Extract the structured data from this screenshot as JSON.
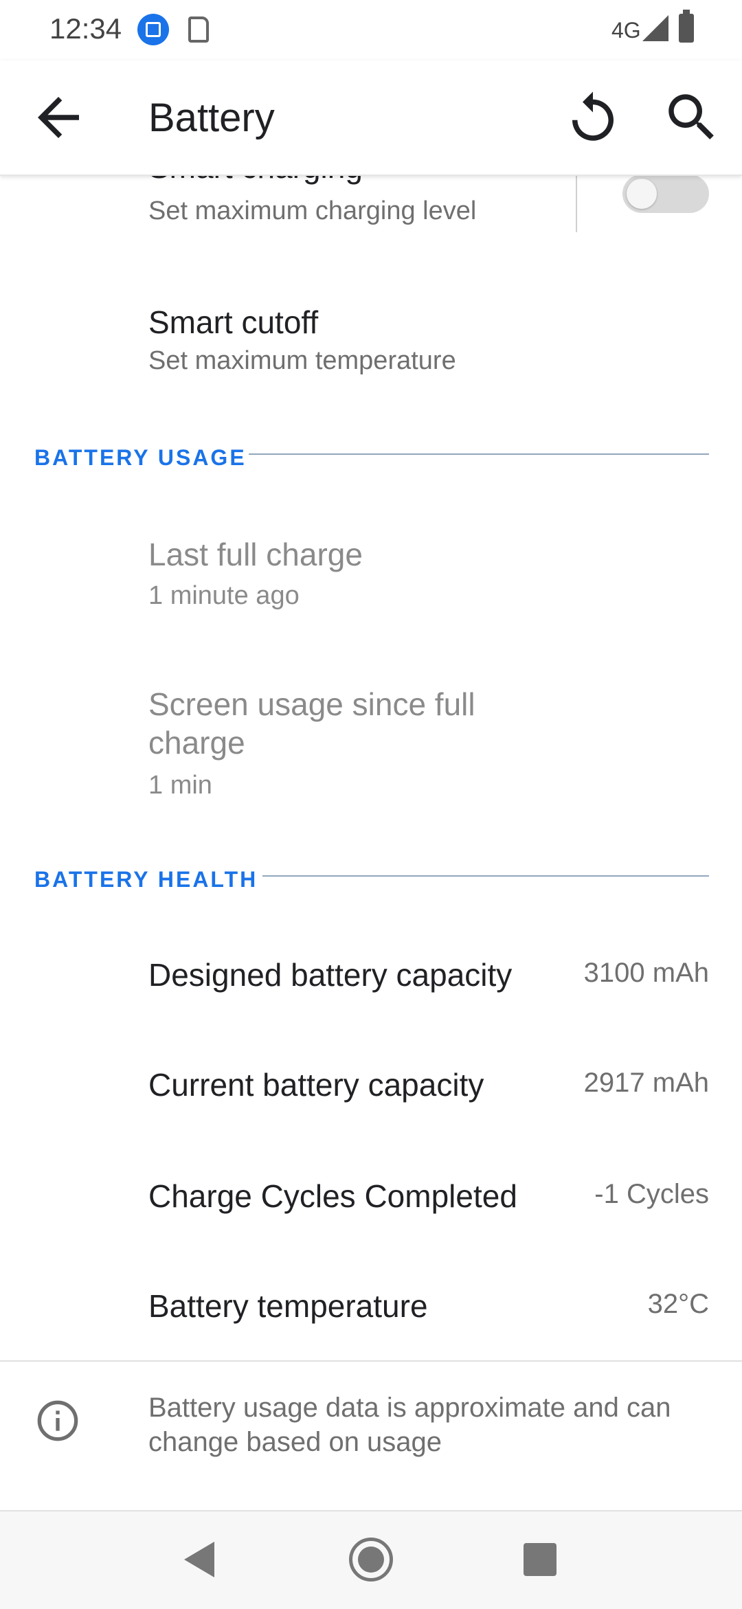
{
  "status_bar": {
    "time": "12:34",
    "network": "4G"
  },
  "app_bar": {
    "title": "Battery"
  },
  "settings": {
    "smart_charging": {
      "title": "Smart charging",
      "summary": "Set maximum charging level",
      "toggle_on": false
    },
    "smart_cutoff": {
      "title": "Smart cutoff",
      "summary": "Set maximum temperature"
    }
  },
  "battery_usage": {
    "header": "BATTERY USAGE",
    "last_full_charge": {
      "title": "Last full charge",
      "summary": "1 minute ago"
    },
    "screen_usage": {
      "title_line1": "Screen usage since full",
      "title_line2": "charge",
      "summary": "1 min"
    }
  },
  "battery_health": {
    "header": "BATTERY HEALTH",
    "rows": [
      {
        "label": "Designed battery capacity",
        "value": "3100 mAh"
      },
      {
        "label": "Current battery capacity",
        "value": "2917 mAh"
      },
      {
        "label": "Charge Cycles Completed",
        "value": "-1 Cycles"
      },
      {
        "label": "Battery temperature",
        "value": "32°C"
      }
    ]
  },
  "footer": {
    "line1": "Battery usage data is approximate and can",
    "line2": "change based on usage"
  },
  "colors": {
    "accent": "#1a73e8",
    "section_line": "#90a7bd",
    "secondary_text": "#6f6f6f"
  },
  "icons": {
    "back": "arrow-left-icon",
    "refresh": "refresh-icon",
    "search": "search-icon",
    "info": "info-icon"
  }
}
